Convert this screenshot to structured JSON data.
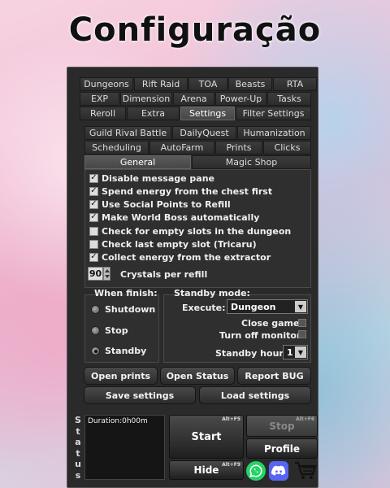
{
  "title": "Configuração",
  "tabs_row1": [
    "Dungeons",
    "Rift Raid",
    "TOA",
    "Beasts",
    "RTA"
  ],
  "tabs_row2": [
    "EXP",
    "Dimension",
    "Arena",
    "Power-Up",
    "Tasks"
  ],
  "tabs_row3": [
    "Reroll",
    "Extra",
    "Settings",
    "Filter Settings"
  ],
  "subtabs_row1": [
    "Guild Rival Battle",
    "DailyQuest",
    "Humanization"
  ],
  "subtabs_row2": [
    "Scheduling",
    "AutoFarm",
    "Prints",
    "Clicks"
  ],
  "subtabs_row3": [
    "General",
    "Magic Shop"
  ],
  "checks": [
    {
      "label": "Disable message pane",
      "checked": true
    },
    {
      "label": "Spend energy from the chest first",
      "checked": true
    },
    {
      "label": "Use Social Points to Refill",
      "checked": true
    },
    {
      "label": "Make World Boss automatically",
      "checked": true
    },
    {
      "label": "Check for empty slots in the dungeon",
      "checked": false
    },
    {
      "label": "Check last empty slot (Tricaru)",
      "checked": false
    },
    {
      "label": "Collect energy from the extractor",
      "checked": true
    }
  ],
  "crystals": {
    "value": "90",
    "label": "Crystals per refill"
  },
  "when_finish": {
    "heading": "When finish:",
    "options": [
      "Shutdown",
      "Stop",
      "Standby"
    ],
    "selected": "Standby"
  },
  "standby": {
    "heading": "Standby mode:",
    "execute_label": "Execute:",
    "execute_value": "Dungeon",
    "close_game": "Close game",
    "turn_off_monitor": "Turn off monitor",
    "hour_label": "Standby hour:",
    "hour_value": "1"
  },
  "buttons": {
    "open_prints": "Open prints",
    "open_status": "Open Status",
    "report_bug": "Report BUG",
    "save_settings": "Save settings",
    "load_settings": "Load settings"
  },
  "status": {
    "letters": [
      "S",
      "t",
      "a",
      "t",
      "u",
      "s"
    ],
    "text": "Duration:0h00m"
  },
  "controls": {
    "start": "Start",
    "start_hotkey": "Alt+F5",
    "stop": "Stop",
    "stop_hotkey": "Alt+F6",
    "profile": "Profile",
    "hide": "Hide",
    "hide_hotkey": "Alt+F9"
  },
  "colors": {
    "panel": "#2a2a2a",
    "whatsapp": "#25d366",
    "discord": "#5865f2"
  },
  "icons": [
    "whatsapp-icon",
    "discord-icon",
    "cart-icon"
  ]
}
